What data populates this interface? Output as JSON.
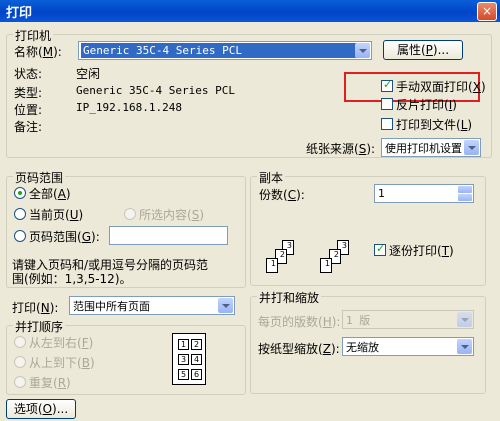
{
  "window": {
    "title": "打印",
    "close_glyph": "×"
  },
  "printer": {
    "group_label": "打印机",
    "name_label": "名称",
    "name_key": "M",
    "name_value": "Generic 35C-4 Series PCL",
    "properties_label": "属性",
    "properties_key": "P",
    "status_label": "状态:",
    "status_value": "空闲",
    "type_label": "类型:",
    "type_value": "Generic 35C-4 Series PCL",
    "location_label": "位置:",
    "location_value": "IP_192.168.1.248",
    "comment_label": "备注:",
    "manual_duplex_label": "手动双面打印",
    "manual_duplex_key": "X",
    "manual_duplex_checked": true,
    "reverse_print_label": "反片打印",
    "reverse_print_key": "I",
    "reverse_print_checked": false,
    "print_to_file_label": "打印到文件",
    "print_to_file_key": "L",
    "print_to_file_checked": false,
    "paper_source_label": "纸张来源",
    "paper_source_key": "S",
    "paper_source_value": "使用打印机设置"
  },
  "page_range": {
    "group_label": "页码范围",
    "all_label": "全部",
    "all_key": "A",
    "current_label": "当前页",
    "current_key": "U",
    "selection_label": "所选内容",
    "selection_key": "S",
    "pages_label": "页码范围",
    "pages_key": "G",
    "pages_value": "",
    "hint_line1": "请键入页码和/或用逗号分隔的页码范",
    "hint_line2": "围(例如：1,3,5-12)。",
    "selected": "all"
  },
  "print_what": {
    "label": "打印",
    "key": "N",
    "value": "范围中所有页面"
  },
  "print_order": {
    "group_label": "并打顺序",
    "ltr_label": "从左到右",
    "ltr_key": "F",
    "ttb_label": "从上到下",
    "ttb_key": "B",
    "repeat_label": "重复",
    "repeat_key": "R",
    "cells": [
      "1",
      "2",
      "3",
      "4",
      "5",
      "6"
    ]
  },
  "copies": {
    "group_label": "副本",
    "count_label": "份数",
    "count_key": "C",
    "count_value": "1",
    "collate_label": "逐份打印",
    "collate_key": "T",
    "collate_checked": true,
    "stack_pages": [
      "1",
      "2",
      "3"
    ]
  },
  "zoom": {
    "group_label": "并打和缩放",
    "pages_per_sheet_label": "每页的版数",
    "pages_per_sheet_key": "H",
    "pages_per_sheet_value": "1 版",
    "scale_label": "按纸型缩放",
    "scale_key": "Z",
    "scale_value": "无缩放"
  },
  "options_button": {
    "label": "选项",
    "key": "O"
  }
}
